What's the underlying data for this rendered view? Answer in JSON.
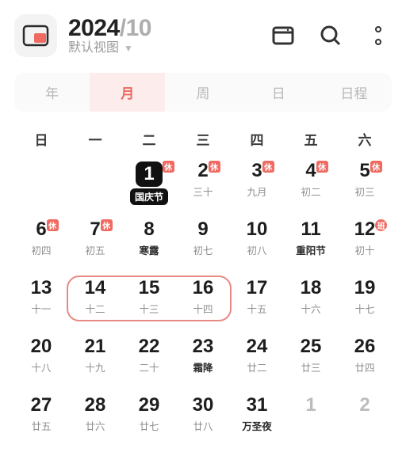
{
  "header": {
    "year": "2024",
    "sep": "/",
    "month": "10",
    "view_label": "默认视图"
  },
  "tabs": [
    {
      "label": "年",
      "active": false
    },
    {
      "label": "月",
      "active": true
    },
    {
      "label": "周",
      "active": false
    },
    {
      "label": "日",
      "active": false
    },
    {
      "label": "日程",
      "active": false
    }
  ],
  "weekdays": [
    "日",
    "一",
    "二",
    "三",
    "四",
    "五",
    "六"
  ],
  "badges": {
    "rest": "休",
    "work": "班"
  },
  "weeks": [
    [
      {},
      {},
      {
        "n": "1",
        "sub": "国庆节",
        "today": true,
        "rest": true,
        "dark": true
      },
      {
        "n": "2",
        "sub": "三十",
        "rest": true
      },
      {
        "n": "3",
        "sub": "九月",
        "rest": true
      },
      {
        "n": "4",
        "sub": "初二",
        "rest": true
      },
      {
        "n": "5",
        "sub": "初三",
        "rest": true
      }
    ],
    [
      {
        "n": "6",
        "sub": "初四",
        "rest": true
      },
      {
        "n": "7",
        "sub": "初五",
        "rest": true
      },
      {
        "n": "8",
        "sub": "寒露",
        "dark": true
      },
      {
        "n": "9",
        "sub": "初七"
      },
      {
        "n": "10",
        "sub": "初八"
      },
      {
        "n": "11",
        "sub": "重阳节",
        "dark": true
      },
      {
        "n": "12",
        "sub": "初十",
        "work": true
      }
    ],
    [
      {
        "n": "13",
        "sub": "十一"
      },
      {
        "n": "14",
        "sub": "十二"
      },
      {
        "n": "15",
        "sub": "十三"
      },
      {
        "n": "16",
        "sub": "十四"
      },
      {
        "n": "17",
        "sub": "十五"
      },
      {
        "n": "18",
        "sub": "十六"
      },
      {
        "n": "19",
        "sub": "十七"
      }
    ],
    [
      {
        "n": "20",
        "sub": "十八"
      },
      {
        "n": "21",
        "sub": "十九"
      },
      {
        "n": "22",
        "sub": "二十"
      },
      {
        "n": "23",
        "sub": "霜降",
        "dark": true
      },
      {
        "n": "24",
        "sub": "廿二"
      },
      {
        "n": "25",
        "sub": "廿三"
      },
      {
        "n": "26",
        "sub": "廿四"
      }
    ],
    [
      {
        "n": "27",
        "sub": "廿五"
      },
      {
        "n": "28",
        "sub": "廿六"
      },
      {
        "n": "29",
        "sub": "廿七"
      },
      {
        "n": "30",
        "sub": "廿八"
      },
      {
        "n": "31",
        "sub": "万圣夜",
        "dark": true
      },
      {
        "n": "1",
        "sub": "",
        "dim": true
      },
      {
        "n": "2",
        "sub": "",
        "dim": true
      }
    ]
  ],
  "selection": {
    "weekIndex": 2,
    "startCol": 1,
    "endCol": 3
  }
}
